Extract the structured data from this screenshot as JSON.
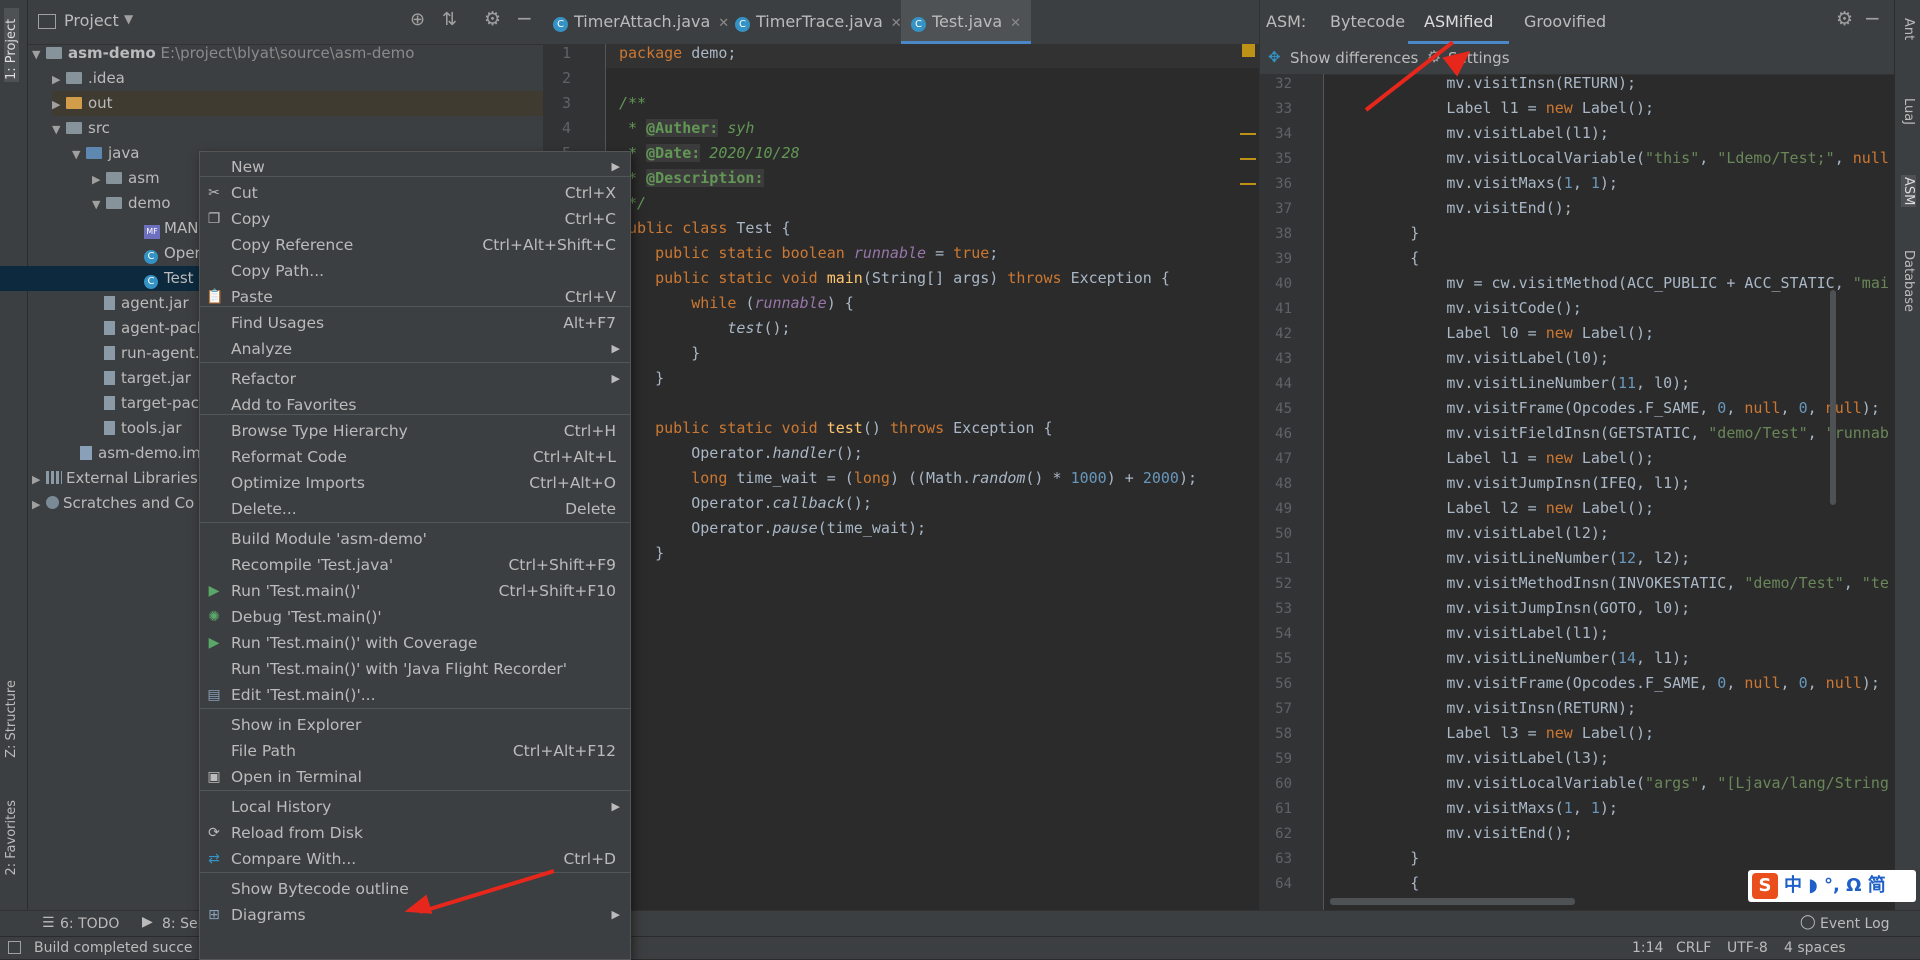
{
  "left_stripe": {
    "project_tab": "1: Project",
    "structure_tab": "Z: Structure",
    "favorites_tab": "2: Favorites"
  },
  "right_stripe": {
    "ant": "Ant",
    "lua": "LuaJ",
    "asm": "ASM",
    "database": "Database"
  },
  "project": {
    "title": "Project",
    "tree": [
      {
        "label": "asm-demo",
        "extra": "E:\\project\\blyat\\source\\asm-demo"
      },
      {
        "label": ".idea"
      },
      {
        "label": "out"
      },
      {
        "label": "src"
      },
      {
        "label": "java"
      },
      {
        "label": "asm"
      },
      {
        "label": "demo"
      },
      {
        "label": "MAN"
      },
      {
        "label": "Oper"
      },
      {
        "label": "Test"
      },
      {
        "label": "agent.jar"
      },
      {
        "label": "agent-pack"
      },
      {
        "label": "run-agent."
      },
      {
        "label": "target.jar"
      },
      {
        "label": "target-pac"
      },
      {
        "label": "tools.jar"
      },
      {
        "label": "asm-demo.im"
      },
      {
        "label": "External Libraries"
      },
      {
        "label": "Scratches and Co"
      }
    ]
  },
  "editor": {
    "tabs": [
      "TimerAttach.java",
      "TimerTrace.java",
      "Test.java"
    ],
    "line_numbers": [
      "1",
      "2",
      "3",
      "4",
      "5"
    ]
  },
  "asm": {
    "label": "ASM:",
    "tabs": [
      "Bytecode",
      "ASMified",
      "Groovified"
    ],
    "toolbar": {
      "show_differences": "Show differences",
      "settings": "Settings"
    },
    "line_numbers": [
      "32",
      "33",
      "34",
      "35",
      "36",
      "37",
      "38",
      "39",
      "40",
      "41",
      "42",
      "43",
      "44",
      "45",
      "46",
      "47",
      "48",
      "49",
      "50",
      "51",
      "52",
      "53",
      "54",
      "55",
      "56",
      "57",
      "58",
      "59",
      "60",
      "61",
      "62",
      "63",
      "64"
    ]
  },
  "context_menu": {
    "items": [
      {
        "label": "New",
        "shortcut": ""
      },
      {
        "label": "Cut",
        "shortcut": "Ctrl+X"
      },
      {
        "label": "Copy",
        "shortcut": "Ctrl+C"
      },
      {
        "label": "Copy Reference",
        "shortcut": "Ctrl+Alt+Shift+C"
      },
      {
        "label": "Copy Path...",
        "shortcut": ""
      },
      {
        "label": "Paste",
        "shortcut": "Ctrl+V"
      },
      {
        "label": "Find Usages",
        "shortcut": "Alt+F7"
      },
      {
        "label": "Analyze",
        "shortcut": ""
      },
      {
        "label": "Refactor",
        "shortcut": ""
      },
      {
        "label": "Add to Favorites",
        "shortcut": ""
      },
      {
        "label": "Browse Type Hierarchy",
        "shortcut": "Ctrl+H"
      },
      {
        "label": "Reformat Code",
        "shortcut": "Ctrl+Alt+L"
      },
      {
        "label": "Optimize Imports",
        "shortcut": "Ctrl+Alt+O"
      },
      {
        "label": "Delete...",
        "shortcut": "Delete"
      },
      {
        "label": "Build Module 'asm-demo'",
        "shortcut": ""
      },
      {
        "label": "Recompile 'Test.java'",
        "shortcut": "Ctrl+Shift+F9"
      },
      {
        "label": "Run 'Test.main()'",
        "shortcut": "Ctrl+Shift+F10"
      },
      {
        "label": "Debug 'Test.main()'",
        "shortcut": ""
      },
      {
        "label": "Run 'Test.main()' with Coverage",
        "shortcut": ""
      },
      {
        "label": "Run 'Test.main()' with 'Java Flight Recorder'",
        "shortcut": ""
      },
      {
        "label": "Edit 'Test.main()'...",
        "shortcut": ""
      },
      {
        "label": "Show in Explorer",
        "shortcut": ""
      },
      {
        "label": "File Path",
        "shortcut": "Ctrl+Alt+F12"
      },
      {
        "label": "Open in Terminal",
        "shortcut": ""
      },
      {
        "label": "Local History",
        "shortcut": ""
      },
      {
        "label": "Reload from Disk",
        "shortcut": ""
      },
      {
        "label": "Compare With...",
        "shortcut": "Ctrl+D"
      },
      {
        "label": "Show Bytecode outline",
        "shortcut": ""
      },
      {
        "label": "Diagrams",
        "shortcut": ""
      }
    ]
  },
  "bottom": {
    "todo": "6: TODO",
    "services": "8: Ser",
    "event_log": "Event Log",
    "status_message": "Build completed succe",
    "position": "1:14",
    "line_sep": "CRLF",
    "encoding": "UTF-8",
    "indent": "4 spaces"
  },
  "ime": {
    "text": "中 ◗ °, Ω 简"
  },
  "colors": {
    "accent": "#4a88c7",
    "keyword": "#cc7832",
    "comment": "#629755",
    "number": "#6897bb",
    "string": "#6a8759",
    "annotation_arrow": "#e8271c"
  }
}
